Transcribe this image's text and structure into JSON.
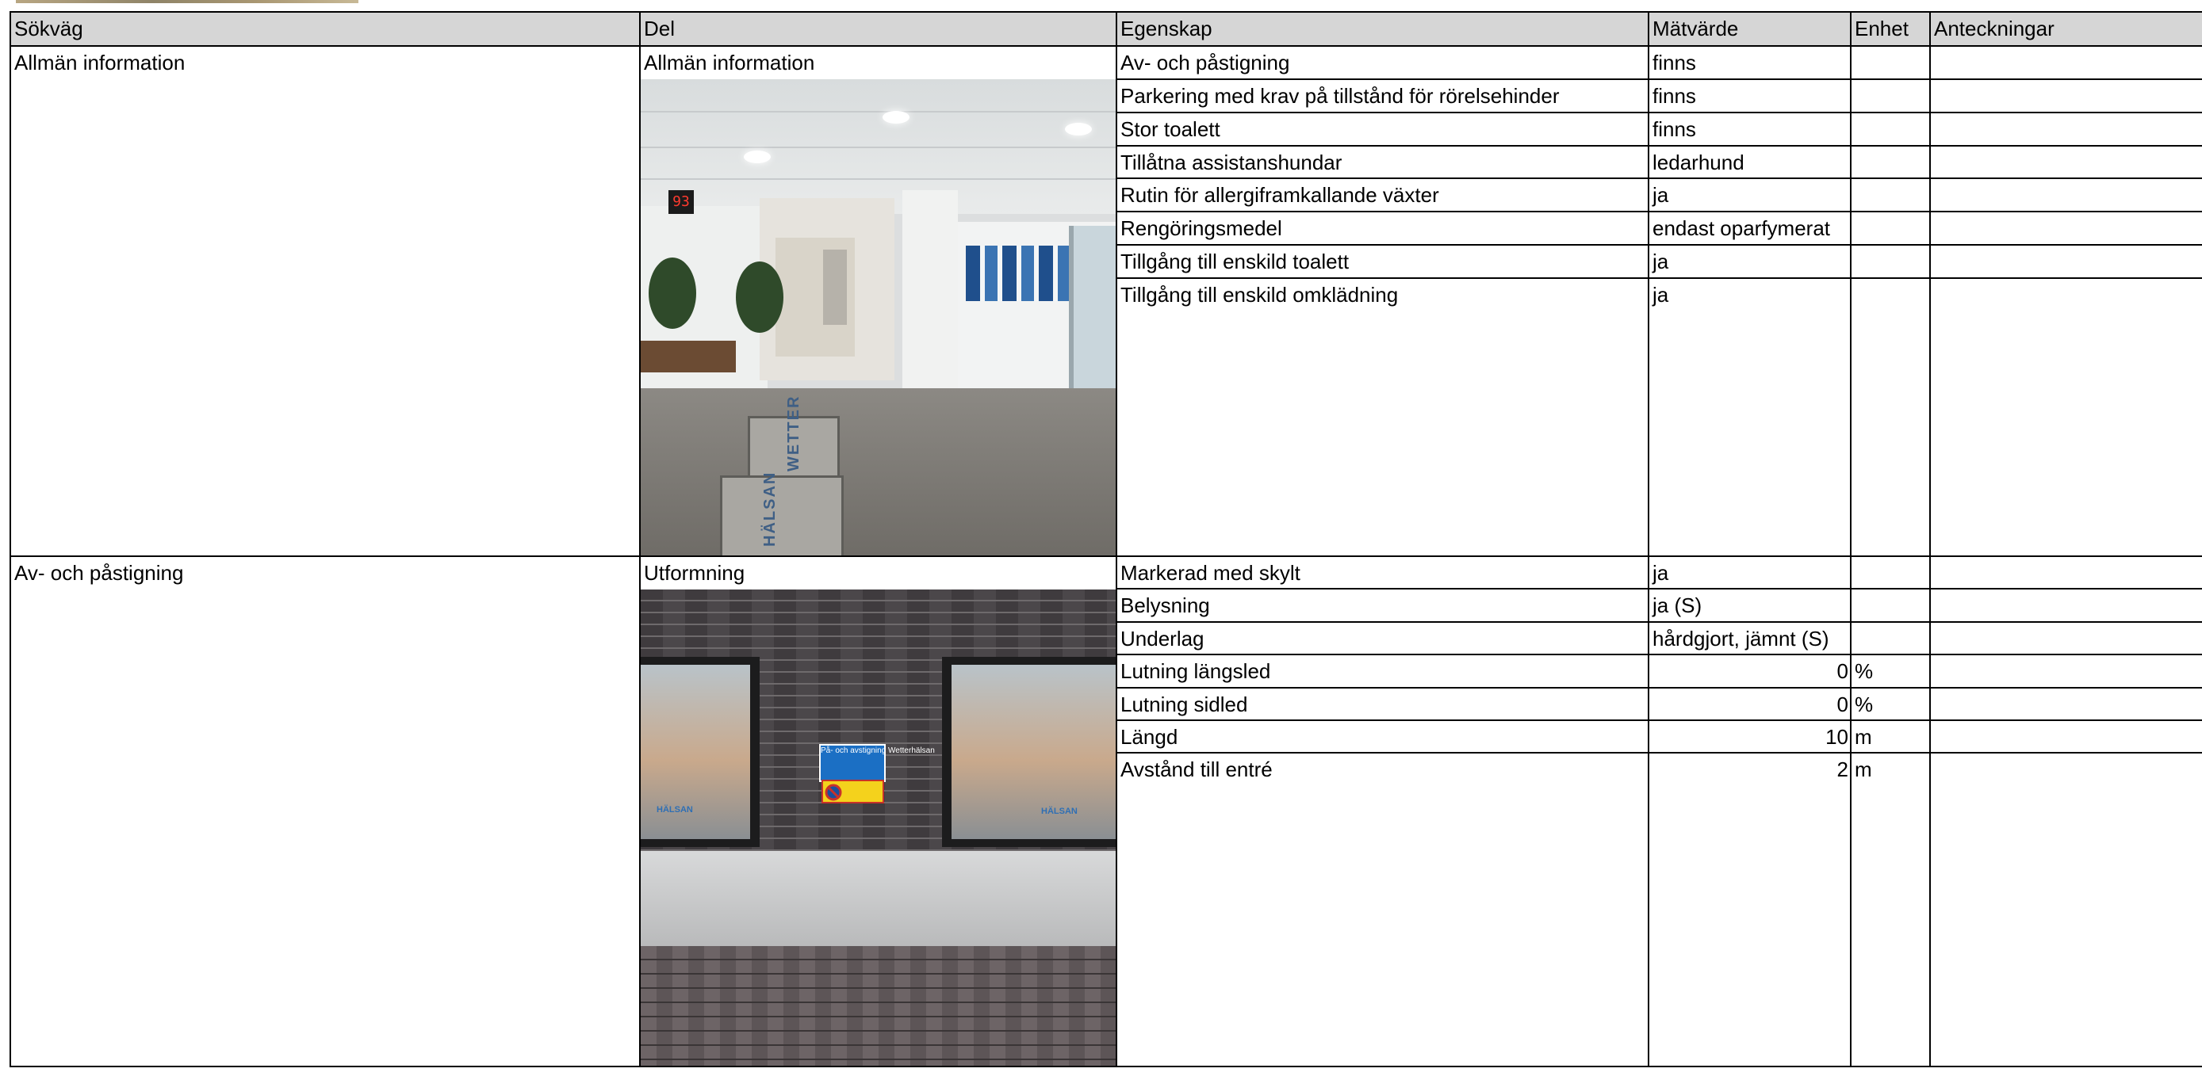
{
  "columns": [
    "Sökväg",
    "Del",
    "Egenskap",
    "Mätvärde",
    "Enhet",
    "Anteckningar"
  ],
  "sections": [
    {
      "path": "Allmän information",
      "part": "Allmän information",
      "photo": "lobby-photo",
      "rows": [
        {
          "property": "Av- och påstigning",
          "value": "finns",
          "unit": "",
          "notes": ""
        },
        {
          "property": "Parkering med krav på tillstånd för rörelsehinder",
          "value": "finns",
          "unit": "",
          "notes": ""
        },
        {
          "property": "Stor toalett",
          "value": "finns",
          "unit": "",
          "notes": ""
        },
        {
          "property": "Tillåtna assistanshundar",
          "value": "ledarhund",
          "unit": "",
          "notes": ""
        },
        {
          "property": "Rutin för allergiframkallande växter",
          "value": "ja",
          "unit": "",
          "notes": ""
        },
        {
          "property": "Rengöringsmedel",
          "value": "endast oparfymerat",
          "unit": "",
          "notes": ""
        },
        {
          "property": "Tillgång till enskild toalett",
          "value": "ja",
          "unit": "",
          "notes": ""
        },
        {
          "property": "Tillgång till enskild omklädning",
          "value": "ja",
          "unit": "",
          "notes": ""
        }
      ]
    },
    {
      "path": "Av- och påstigning",
      "part": "Utformning",
      "photo": "facade-photo",
      "rows": [
        {
          "property": "Markerad med skylt",
          "value": "ja",
          "unit": "",
          "notes": ""
        },
        {
          "property": "Belysning",
          "value": "ja (S)",
          "unit": "",
          "notes": ""
        },
        {
          "property": "Underlag",
          "value": "hårdgjort, jämnt (S)",
          "unit": "",
          "notes": ""
        },
        {
          "property": "Lutning längsled",
          "value": "0",
          "unit": "%",
          "notes": ""
        },
        {
          "property": "Lutning sidled",
          "value": "0",
          "unit": "%",
          "notes": ""
        },
        {
          "property": "Längd",
          "value": "10",
          "unit": "m",
          "notes": ""
        },
        {
          "property": "Avstånd till entré",
          "value": "2",
          "unit": "m",
          "notes": ""
        }
      ]
    }
  ],
  "photo_texts": {
    "lobby_clock": "93",
    "lobby_mat_top": "WETTER",
    "lobby_mat_bottom": "HÄLSAN",
    "facade_sign": "På- och avstigning Wetterhälsan",
    "facade_parking_sign": "Parkering förbjuden",
    "facade_window_logo": "HÄLSAN"
  }
}
